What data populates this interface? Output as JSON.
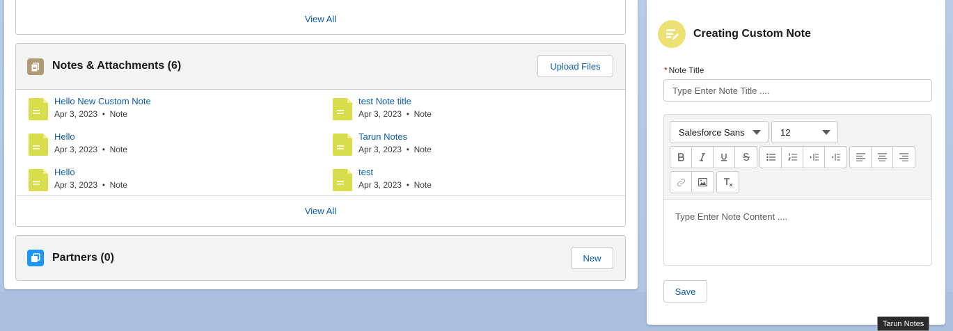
{
  "top_card": {
    "view_all": "View All"
  },
  "notes_card": {
    "title": "Notes & Attachments (6)",
    "upload_button": "Upload Files",
    "view_all": "View All",
    "items": [
      {
        "title": "Hello New Custom Note",
        "date": "Apr 3, 2023",
        "type": "Note"
      },
      {
        "title": "test Note title",
        "date": "Apr 3, 2023",
        "type": "Note"
      },
      {
        "title": "Hello",
        "date": "Apr 3, 2023",
        "type": "Note"
      },
      {
        "title": "Tarun Notes",
        "date": "Apr 3, 2023",
        "type": "Note"
      },
      {
        "title": "Hello",
        "date": "Apr 3, 2023",
        "type": "Note"
      },
      {
        "title": "test",
        "date": "Apr 3, 2023",
        "type": "Note"
      }
    ],
    "separator": "•"
  },
  "partners_card": {
    "title": "Partners (0)",
    "new_button": "New"
  },
  "custom_note": {
    "title": "Creating Custom Note",
    "required_mark": "*",
    "title_label": "Note Title",
    "title_placeholder": "Type Enter Note Title ....",
    "font_family": "Salesforce Sans",
    "font_size": "12",
    "content_placeholder": "Type Enter Note Content ....",
    "save_button": "Save"
  },
  "tooltip": "Tarun Notes",
  "colors": {
    "link": "#0b5cab",
    "note_icon": "#d8dd4b",
    "notes_header_icon": "#b09a76",
    "partners_icon": "#1b96ff",
    "custom_note_icon": "#eee173",
    "required": "#ba0517"
  },
  "icons": {
    "notes_header": "notes-attachments-icon",
    "partners": "partners-icon",
    "custom_note": "note-edit-icon",
    "note_item": "note-file-icon"
  }
}
